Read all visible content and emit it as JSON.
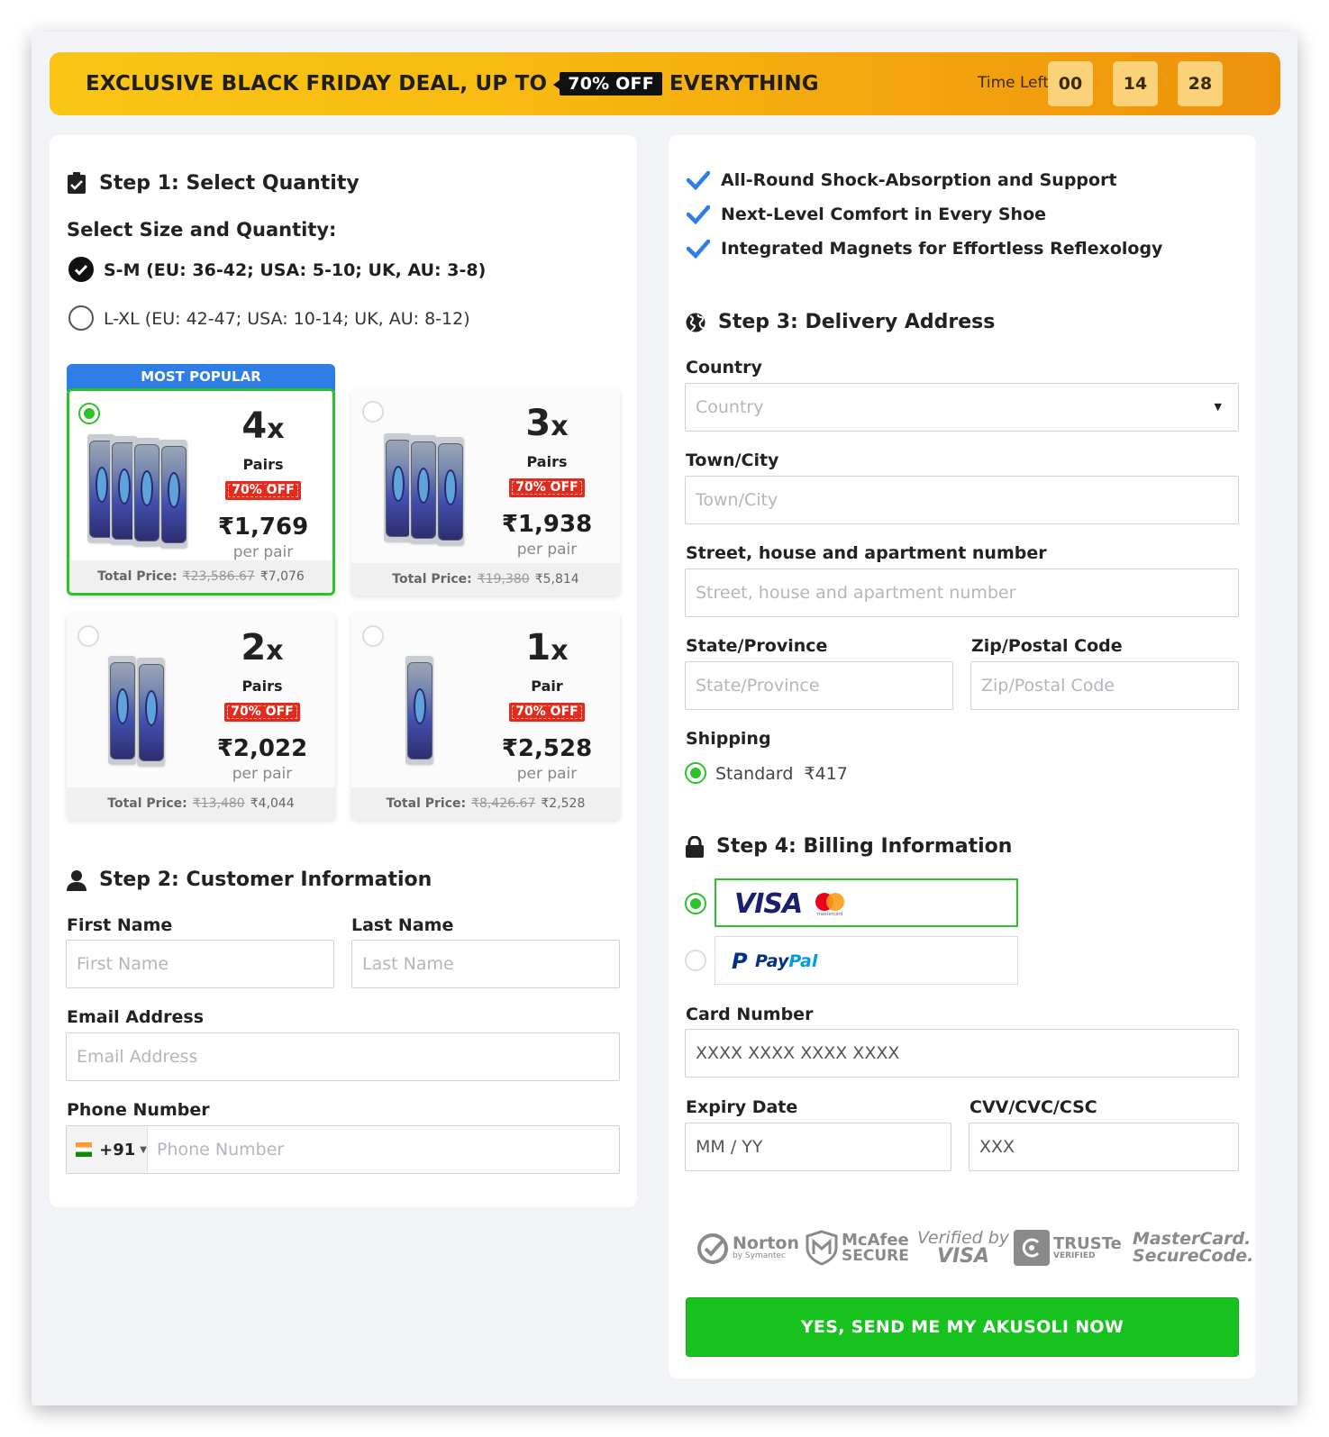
{
  "banner": {
    "text_before": "EXCLUSIVE BLACK FRIDAY DEAL, UP TO",
    "highlight": "70% OFF",
    "text_after": "EVERYTHING",
    "time_left_label": "Time Left",
    "timer": {
      "hours": "00",
      "minutes": "14",
      "seconds": "28"
    }
  },
  "step1": {
    "title": "Step 1: Select Quantity",
    "subtitle": "Select Size and Quantity:",
    "sizes": [
      {
        "label": "S-M (EU: 36-42; USA: 5-10; UK, AU: 3-8)",
        "selected": true
      },
      {
        "label": "L-XL (EU: 42-47; USA: 10-14; UK, AU: 8-12)",
        "selected": false
      }
    ],
    "most_popular": "MOST POPULAR",
    "offers": [
      {
        "qty": "4",
        "x": "x",
        "unit": "Pairs",
        "discount": "70% OFF",
        "price": "₹1,769",
        "per": "per pair",
        "total_label": "Total Price:",
        "old_total": "₹23,586.67",
        "total": "₹7,076",
        "selected": true
      },
      {
        "qty": "3",
        "x": "x",
        "unit": "Pairs",
        "discount": "70% OFF",
        "price": "₹1,938",
        "per": "per pair",
        "total_label": "Total Price:",
        "old_total": "₹19,380",
        "total": "₹5,814",
        "selected": false
      },
      {
        "qty": "2",
        "x": "x",
        "unit": "Pairs",
        "discount": "70% OFF",
        "price": "₹2,022",
        "per": "per pair",
        "total_label": "Total Price:",
        "old_total": "₹13,480",
        "total": "₹4,044",
        "selected": false
      },
      {
        "qty": "1",
        "x": "x",
        "unit": "Pair",
        "discount": "70% OFF",
        "price": "₹2,528",
        "per": "per pair",
        "total_label": "Total Price:",
        "old_total": "₹8,426.67",
        "total": "₹2,528",
        "selected": false
      }
    ]
  },
  "step2": {
    "title": "Step 2: Customer Information",
    "first_name": {
      "label": "First Name",
      "placeholder": "First Name"
    },
    "last_name": {
      "label": "Last Name",
      "placeholder": "Last Name"
    },
    "email": {
      "label": "Email Address",
      "placeholder": "Email Address"
    },
    "phone": {
      "label": "Phone Number",
      "code": "+91",
      "placeholder": "Phone Number"
    }
  },
  "features": [
    "All-Round Shock-Absorption and Support",
    "Next-Level Comfort in Every Shoe",
    "Integrated Magnets for Effortless Reflexology"
  ],
  "step3": {
    "title": "Step 3: Delivery Address",
    "country": {
      "label": "Country",
      "placeholder": "Country"
    },
    "city": {
      "label": "Town/City",
      "placeholder": "Town/City"
    },
    "street": {
      "label": "Street, house and apartment number",
      "placeholder": "Street, house and apartment number"
    },
    "state": {
      "label": "State/Province",
      "placeholder": "State/Province"
    },
    "zip": {
      "label": "Zip/Postal Code",
      "placeholder": "Zip/Postal Code"
    },
    "shipping_label": "Shipping",
    "shipping_option": "Standard",
    "shipping_price": "₹417"
  },
  "step4": {
    "title": "Step 4: Billing Information",
    "visa": "VISA",
    "mastercard_small": "mastercard",
    "paypal_1": "Pay",
    "paypal_2": "Pal",
    "card_number": {
      "label": "Card Number",
      "placeholder": "XXXX XXXX XXXX XXXX"
    },
    "expiry": {
      "label": "Expiry Date",
      "placeholder": "MM / YY"
    },
    "cvv": {
      "label": "CVV/CVC/CSC",
      "placeholder": "XXX"
    }
  },
  "trust": {
    "norton": "Norton",
    "norton_sub": "by Symantec",
    "mcafee": "McAfee",
    "mcafee_sub": "SECURE",
    "verified_by": "Verified by",
    "verified_visa": "VISA",
    "truste": "TRUSTe",
    "truste_sub": "VERIFIED",
    "mc_1": "MasterCard.",
    "mc_2": "SecureCode."
  },
  "cta": "YES, SEND ME MY AKUSOLI NOW",
  "colors": {
    "accent_green": "#18c21e",
    "blue": "#2f7de6",
    "red": "#e22b1d",
    "banner": "#f9c515"
  }
}
